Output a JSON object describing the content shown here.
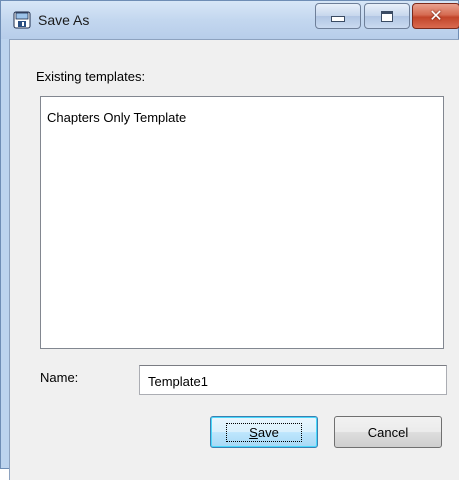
{
  "window": {
    "title": "Save As",
    "icon": "save-as-floppy-icon",
    "controls": {
      "minimize": "minimize-icon",
      "maximize": "maximize-icon",
      "close": "close-icon",
      "close_glyph": "✕"
    }
  },
  "form": {
    "existing_label": "Existing templates:",
    "templates": [
      "Chapters Only Template"
    ],
    "name_label": "Name:",
    "name_value": "Template1"
  },
  "buttons": {
    "save_mnemonic": "S",
    "save_rest": "ave",
    "cancel_label": "Cancel"
  },
  "colors": {
    "accent": "#3c7fb1",
    "close_button": "#c2452a",
    "client_background": "#f0f0f0"
  }
}
